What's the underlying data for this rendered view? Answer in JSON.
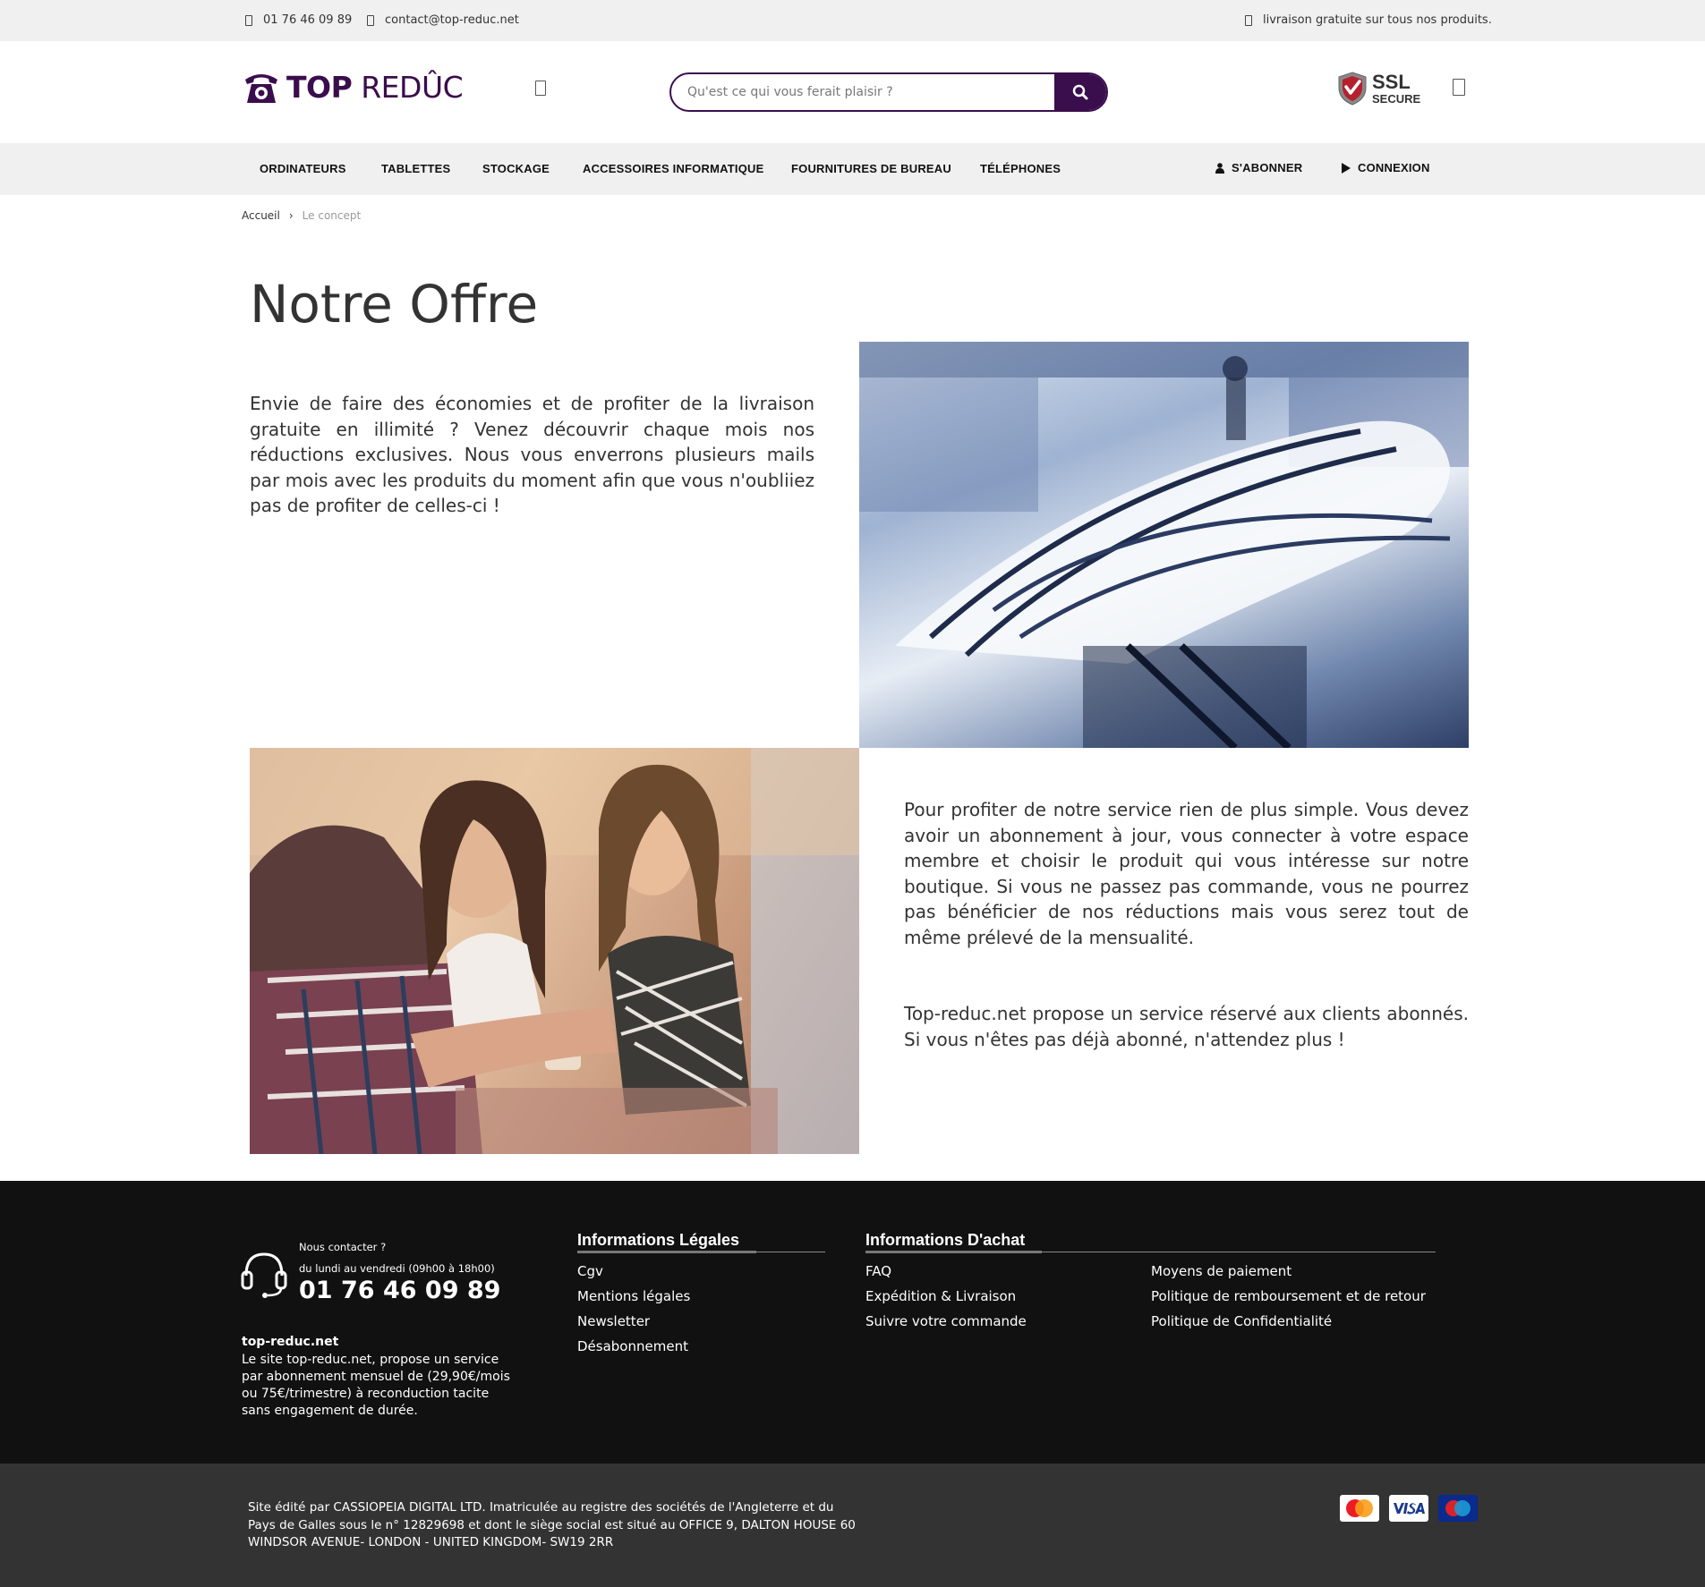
{
  "topbar": {
    "phone": "01 76 46 09 89",
    "email": "contact@top-reduc.net",
    "shipping": "livraison gratuite sur tous nos produits."
  },
  "header": {
    "brand_bold": "TOP",
    "brand_light": "REDÛC",
    "search_placeholder": "Qu'est ce qui vous ferait plaisir ?",
    "ssl_line1": "SSL",
    "ssl_line2": "SECURE"
  },
  "nav": {
    "items": [
      "ORDINATEURS",
      "TABLETTES",
      "STOCKAGE",
      "ACCESSOIRES INFORMATIQUE",
      "FOURNITURES DE BUREAU",
      "TÉLÉPHONES"
    ],
    "subscribe": "S'ABONNER",
    "login": "CONNEXION"
  },
  "breadcrumb": {
    "home": "Accueil",
    "separator": "›",
    "current": "Le concept"
  },
  "content": {
    "title": "Notre Offre",
    "para1": "Envie de faire des économies et de profiter de la livraison gratuite en illimité ? Venez découvrir chaque mois nos réductions exclusives. Nous vous enverrons plusieurs mails par mois avec les produits du moment afin que vous n'oubliiez pas de profiter de celles-ci !",
    "para2": "Pour profiter de notre service rien de plus simple. Vous devez avoir un abonnement à jour, vous connecter à votre espace membre et choisir le produit qui vous intéresse sur notre boutique. Si vous ne passez pas commande, vous ne pourrez pas bénéficier de nos réductions mais vous serez tout de même prélevé de la mensualité.",
    "para3": "Top-reduc.net propose un service réservé aux clients abonnés. Si vous n'êtes pas déjà abonné, n'attendez plus !"
  },
  "footer": {
    "contact_label": "Nous contacter ?",
    "hours": "du lundi au vendredi (09h00 à 18h00)",
    "phone": "01 76 46 09 89",
    "site_name": "top-reduc.net",
    "site_desc": "Le site top-reduc.net, propose un service par abonnement mensuel de (29,90€/mois ou 75€/trimestre) à reconduction tacite sans engagement de durée.",
    "legal_title": "Informations Légales",
    "legal_links": [
      "Cgv",
      "Mentions légales",
      "Newsletter",
      "Désabonnement"
    ],
    "purchase_title": "Informations D'achat",
    "purchase_links_col1": [
      "FAQ",
      "Expédition & Livraison",
      "Suivre votre commande"
    ],
    "purchase_links_col2": [
      "Moyens de paiement",
      "Politique de remboursement et de retour",
      "Politique de Confidentialité"
    ]
  },
  "bottom": {
    "legal": "Site édité par CASSIOPEIA DIGITAL LTD. Imatriculée au registre des sociétés de l'Angleterre et du Pays de Galles sous le n° 12829698 et dont le siège social est situé au OFFICE 9, DALTON HOUSE 60 WINDSOR AVENUE- LONDON - UNITED KINGDOM- SW19 2RR",
    "cards": [
      "MasterCard",
      "VISA",
      "Maestro"
    ]
  },
  "colors": {
    "brand": "#3a0d4c",
    "topbar_bg": "#f0f0f0",
    "footer_bg": "#111111",
    "bottom_bg": "#333333"
  }
}
